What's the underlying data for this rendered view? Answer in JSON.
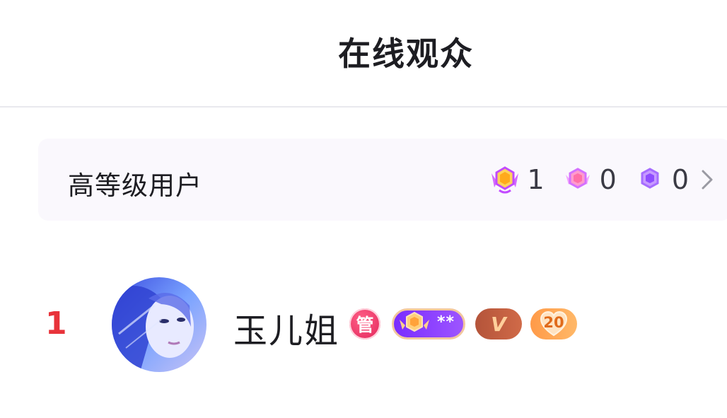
{
  "header": {
    "title": "在线观众"
  },
  "high_level": {
    "label": "高等级用户",
    "stats": [
      {
        "icon": "gold-rank-badge-icon",
        "count": "1"
      },
      {
        "icon": "pink-rank-badge-icon",
        "count": "0"
      },
      {
        "icon": "purple-rank-badge-icon",
        "count": "0"
      }
    ]
  },
  "viewers": [
    {
      "rank": "1",
      "name": "玉儿姐",
      "admin_badge": "管",
      "level_badge": "**",
      "vip_badge": "V",
      "fan_level": "20"
    }
  ],
  "colors": {
    "rank": "#e8333a",
    "admin": "#e1245a",
    "level": "#7a2cff",
    "vip": "#c1603f",
    "fan": "#ffa657"
  }
}
